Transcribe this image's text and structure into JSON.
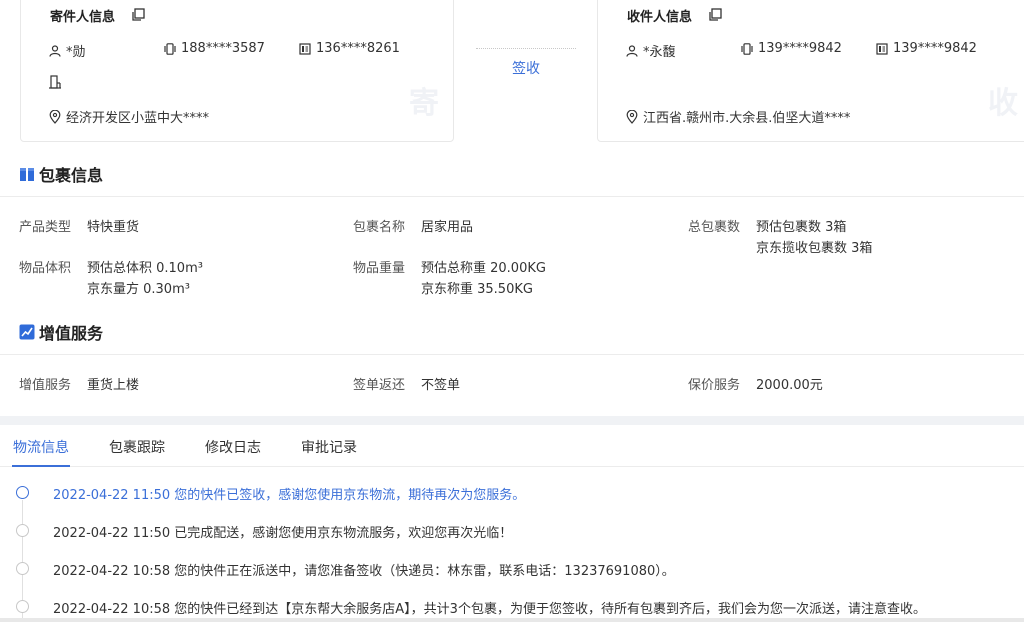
{
  "sender": {
    "title": "寄件人信息",
    "name": "*勋",
    "mobile": "188****3587",
    "phone": "136****8261",
    "address": "经济开发区小蓝中大****",
    "watermark": "寄"
  },
  "receiver": {
    "title": "收件人信息",
    "name": "*永馥",
    "mobile": "139****9842",
    "phone": "139****9842",
    "address": "江西省.赣州市.大余县.伯坚大道****",
    "watermark": "收"
  },
  "sign_status": "签收",
  "package_section": {
    "title": "包裹信息",
    "product_type_label": "产品类型",
    "product_type_value": "特快重货",
    "package_name_label": "包裹名称",
    "package_name_value": "居家用品",
    "total_count_label": "总包裹数",
    "total_count_line1": "预估包裹数 3箱",
    "total_count_line2": "京东揽收包裹数 3箱",
    "volume_label": "物品体积",
    "volume_line1": "预估总体积 0.10m³",
    "volume_line2": "京东量方 0.30m³",
    "weight_label": "物品重量",
    "weight_line1": "预估总称重 20.00KG",
    "weight_line2": "京东称重 35.50KG"
  },
  "value_added_section": {
    "title": "增值服务",
    "service_label": "增值服务",
    "service_value": "重货上楼",
    "sign_return_label": "签单返还",
    "sign_return_value": "不签单",
    "insured_label": "保价服务",
    "insured_value": "2000.00元"
  },
  "tabs": [
    {
      "label": "物流信息"
    },
    {
      "label": "包裹跟踪"
    },
    {
      "label": "修改日志"
    },
    {
      "label": "审批记录"
    }
  ],
  "timeline": [
    {
      "text": "2022-04-22 11:50 您的快件已签收，感谢您使用京东物流，期待再次为您服务。"
    },
    {
      "text": "2022-04-22 11:50 已完成配送，感谢您使用京东物流服务，欢迎您再次光临！"
    },
    {
      "text": "2022-04-22 10:58 您的快件正在派送中，请您准备签收（快递员：林东雷，联系电话：13237691080）。"
    },
    {
      "text": "2022-04-22 10:58 您的快件已经到达【京东帮大余服务店A】，共计3个包裹，为便于您签收，待所有包裹到齐后，我们会为您一次派送，请注意查收。"
    }
  ],
  "colors": {
    "accent": "#3b6fd8",
    "section_icon": "#2f6bd9"
  }
}
